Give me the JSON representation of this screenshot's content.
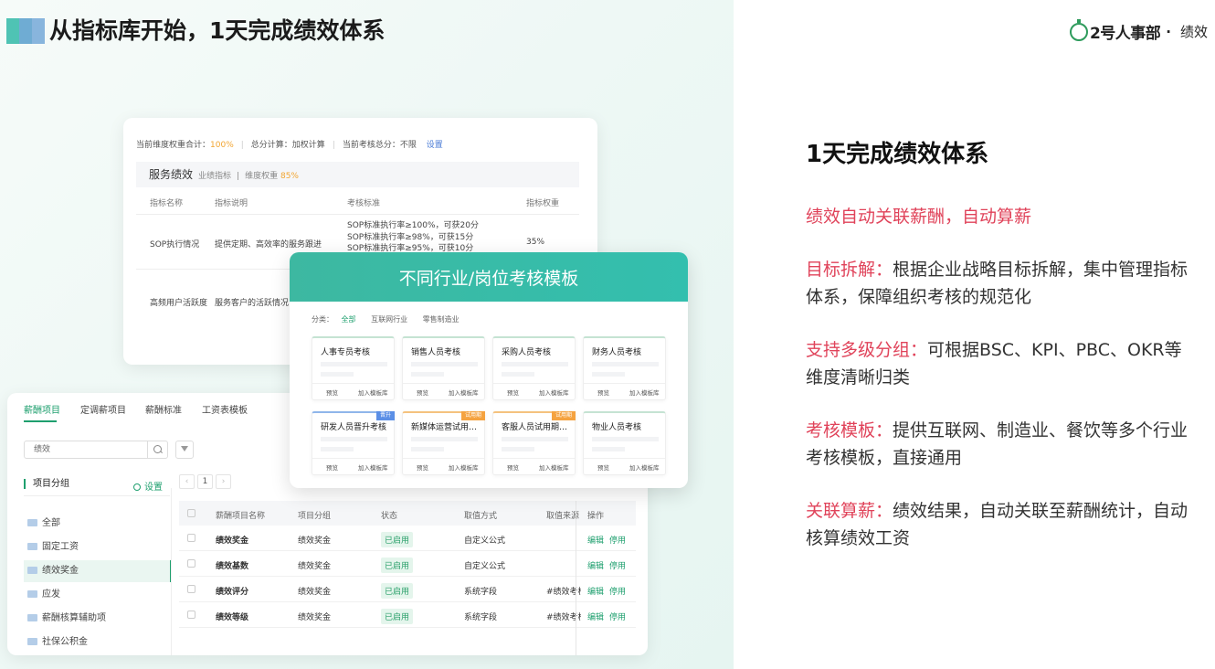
{
  "header": {
    "title": "从指标库开始，1天完成绩效体系",
    "brand_name": "2号人事部",
    "brand_dot": "·",
    "brand_product": "绩效"
  },
  "right": {
    "heading": "1天完成绩效体系",
    "features": [
      {
        "key": "绩效自动关联薪酬，自动算薪",
        "text": ""
      },
      {
        "key": "目标拆解：",
        "text": "根据企业战略目标拆解，集中管理指标体系，保障组织考核的规范化"
      },
      {
        "key": "支持多级分组：",
        "text": "可根据BSC、KPI、PBC、OKR等维度清晰归类"
      },
      {
        "key": "考核模板：",
        "text": "提供互联网、制造业、餐饮等多个行业考核模板，直接通用"
      },
      {
        "key": "关联算薪：",
        "text": "绩效结果，自动关联至薪酬统计，自动核算绩效工资"
      }
    ]
  },
  "indicator_card": {
    "weight_label": "当前维度权重合计：",
    "weight_value": "100%",
    "calc_label": "总分计算：加权计算",
    "total_label": "当前考核总分：不限",
    "settings_link": "设置",
    "section_title": "服务绩效",
    "section_sub": "业绩指标",
    "section_weight_label": "维度权重",
    "section_weight_value": "85%",
    "columns": [
      "指标名称",
      "指标说明",
      "考核标准",
      "指标权重"
    ],
    "rows": [
      {
        "name": "SOP执行情况",
        "desc": "提供定期、高效率的服务跟进",
        "criteria": [
          "SOP标准执行率≥100%，可获20分",
          "SOP标准执行率≥98%，可获15分",
          "SOP标准执行率≥95%，可获10分"
        ],
        "weight": "35%"
      },
      {
        "name": "高频用户活跃度",
        "desc": "服务客户的活跃情况",
        "criteria": [],
        "weight": ""
      }
    ]
  },
  "salary_card": {
    "tabs": [
      "薪酬项目",
      "定调薪项目",
      "薪酬标准",
      "工资表模板"
    ],
    "search_value": "绩效",
    "group_title": "项目分组",
    "group_settings": "设置",
    "groups": [
      "全部",
      "固定工资",
      "绩效奖金",
      "应发",
      "薪酬核算辅助项",
      "社保公积金"
    ],
    "page_current": "1",
    "page_prev": "‹",
    "page_next": "›",
    "columns": [
      "薪酬项目名称",
      "项目分组",
      "状态",
      "取值方式",
      "取值来源",
      "操作"
    ],
    "rows": [
      {
        "name": "绩效奖金",
        "group": "绩效奖金",
        "status": "已启用",
        "method": "自定义公式",
        "source": "",
        "edit": "编辑",
        "disable": "停用"
      },
      {
        "name": "绩效基数",
        "group": "绩效奖金",
        "status": "已启用",
        "method": "自定义公式",
        "source": "",
        "edit": "编辑",
        "disable": "停用"
      },
      {
        "name": "绩效评分",
        "group": "绩效奖金",
        "status": "已启用",
        "method": "系统字段",
        "source": "#绩效考核",
        "edit": "编辑",
        "disable": "停用"
      },
      {
        "name": "绩效等级",
        "group": "绩效奖金",
        "status": "已启用",
        "method": "系统字段",
        "source": "#绩效考核",
        "edit": "编辑",
        "disable": "停用"
      }
    ]
  },
  "template_card": {
    "title": "不同行业/岗位考核模板",
    "category_label": "分类：",
    "categories": [
      "全部",
      "互联网行业",
      "零售制造业"
    ],
    "preview": "预览",
    "add": "加入模板库",
    "templates": [
      {
        "name": "人事专员考核",
        "tag": ""
      },
      {
        "name": "销售人员考核",
        "tag": ""
      },
      {
        "name": "采购人员考核",
        "tag": ""
      },
      {
        "name": "财务人员考核",
        "tag": ""
      },
      {
        "name": "研发人员晋升考核",
        "tag": "晋升"
      },
      {
        "name": "新媒体运营试用期考核",
        "tag": "试用期"
      },
      {
        "name": "客服人员试用期考核",
        "tag": "试用期"
      },
      {
        "name": "物业人员考核",
        "tag": ""
      }
    ]
  },
  "colors": {
    "accent": "#1e9f6e",
    "highlight": "#e0435a",
    "header_gradient": "#3db8a1"
  }
}
